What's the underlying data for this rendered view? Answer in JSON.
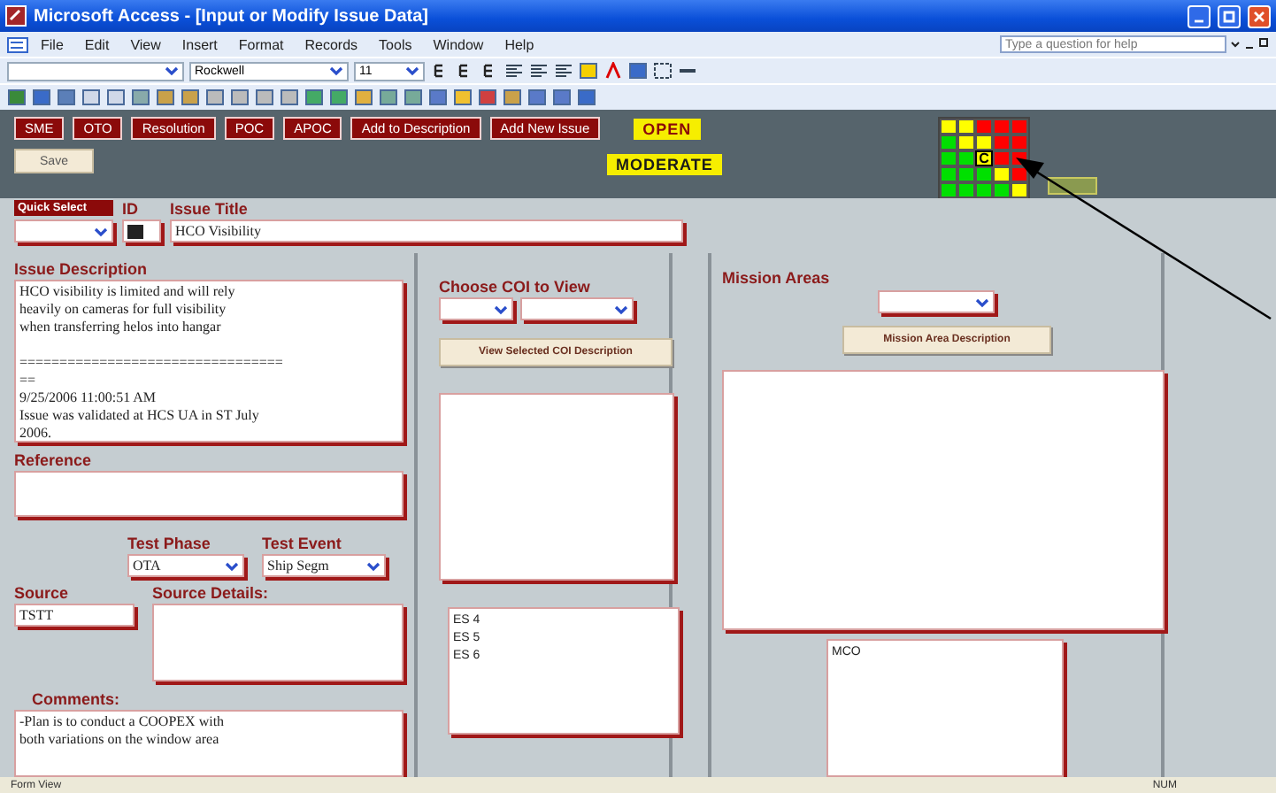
{
  "window": {
    "title": "Microsoft Access - [Input or Modify Issue Data]"
  },
  "menu": [
    "File",
    "Edit",
    "View",
    "Insert",
    "Format",
    "Records",
    "Tools",
    "Window",
    "Help"
  ],
  "help_box": {
    "placeholder": "Type a question for help"
  },
  "toolbar": {
    "font": "Rockwell",
    "size": "11"
  },
  "form": {
    "nav_buttons": [
      "SME",
      "OTO",
      "Resolution",
      "POC",
      "APOC",
      "Add to Description",
      "Add New Issue"
    ],
    "status_label": "OPEN",
    "save_button": "Save",
    "risk_level": "MODERATE",
    "risk_matrix": {
      "marker": "C",
      "rows": [
        [
          {
            "color": "#ffff00",
            "selected": false
          },
          {
            "color": "#ffff00",
            "selected": false
          },
          {
            "color": "#ff0000",
            "selected": false
          },
          {
            "color": "#ff0000",
            "selected": false
          },
          {
            "color": "#ff0000",
            "selected": false
          }
        ],
        [
          {
            "color": "#00e000",
            "selected": false
          },
          {
            "color": "#ffff00",
            "selected": false
          },
          {
            "color": "#ffff00",
            "selected": false
          },
          {
            "color": "#ff0000",
            "selected": false
          },
          {
            "color": "#ff0000",
            "selected": false
          }
        ],
        [
          {
            "color": "#00e000",
            "selected": false
          },
          {
            "color": "#00e000",
            "selected": false
          },
          {
            "color": "#ffff00",
            "selected": true
          },
          {
            "color": "#ff0000",
            "selected": false
          },
          {
            "color": "#ff0000",
            "selected": false
          }
        ],
        [
          {
            "color": "#00e000",
            "selected": false
          },
          {
            "color": "#00e000",
            "selected": false
          },
          {
            "color": "#00e000",
            "selected": false
          },
          {
            "color": "#ffff00",
            "selected": false
          },
          {
            "color": "#ff0000",
            "selected": false
          }
        ],
        [
          {
            "color": "#00e000",
            "selected": false
          },
          {
            "color": "#00e000",
            "selected": false
          },
          {
            "color": "#00e000",
            "selected": false
          },
          {
            "color": "#00e000",
            "selected": false
          },
          {
            "color": "#ffff00",
            "selected": false
          }
        ]
      ]
    },
    "quick_select": {
      "label": "Quick Select"
    },
    "id": {
      "label": "ID"
    },
    "issue_title": {
      "label": "Issue Title",
      "value": "HCO Visibility"
    },
    "issue_description": {
      "label": "Issue Description",
      "value": "HCO visibility is limited and will rely\nheavily on cameras for full visibility\nwhen transferring helos into hangar\n\n=================================\n==\n9/25/2006 11:00:51 AM\nIssue was validated at HCS UA in ST July\n2006."
    },
    "reference": {
      "label": "Reference"
    },
    "test_phase": {
      "label": "Test Phase",
      "value": "OTA"
    },
    "test_event": {
      "label": "Test Event",
      "value": "Ship Segm"
    },
    "source": {
      "label": "Source",
      "value": "TSTT"
    },
    "source_details": {
      "label": "Source Details:"
    },
    "comments": {
      "label": "Comments:",
      "value": "-Plan is to conduct a COOPEX with\nboth variations on the window area"
    },
    "coi": {
      "label": "Choose COI to View",
      "button": "View Selected COI Description",
      "list": [
        "ES 4",
        "ES 5",
        "ES 6"
      ]
    },
    "mission": {
      "label": "Mission Areas",
      "button": "Mission Area Description",
      "list": [
        "MCO"
      ]
    }
  },
  "status_bar": {
    "left": "Form View",
    "right": "NUM"
  }
}
